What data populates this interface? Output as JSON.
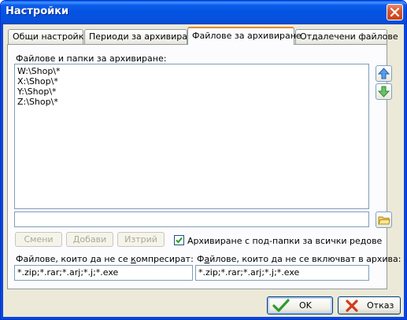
{
  "window": {
    "title": "Настройки"
  },
  "tabs": [
    {
      "label": "Общи настройки",
      "active": false
    },
    {
      "label": "Периоди за архивиране",
      "active": false
    },
    {
      "label": "Файлове за архивиране",
      "active": true
    },
    {
      "label": "Отдалечени файлове",
      "active": false
    }
  ],
  "panel": {
    "list_label": "Файлове и папки за архивиране:",
    "items": [
      "W:\\Shop\\*",
      "X:\\Shop\\*",
      "Y:\\Shop\\*",
      "Z:\\Shop\\*"
    ],
    "path_value": "",
    "buttons": {
      "change": "Смени",
      "add": "Добави",
      "delete": "Изтрий"
    },
    "recursive": {
      "label": "Архивиране с под-папки за всички редове",
      "checked": true
    },
    "no_compress": {
      "label_prefix": "Файлове, които да не се ",
      "label_underlined": "к",
      "label_suffix": "омпресират:",
      "value": "*.zip;*.rar;*.arj;*.j;*.exe"
    },
    "no_include": {
      "label_prefix": "Ф",
      "label_underlined": "а",
      "label_suffix": "йлове, които да не се включват в архива:",
      "value": "*.zip;*.rar;*.arj;*.j;*.exe"
    }
  },
  "footer": {
    "ok": "OK",
    "cancel": "Отказ"
  },
  "colors": {
    "title_bar": "#0553e3",
    "tab_highlight": "#e68b2c",
    "arrow_green": "#2f9a2f",
    "arrow_blue": "#3b82d9",
    "cancel_x": "#d23b1c"
  }
}
